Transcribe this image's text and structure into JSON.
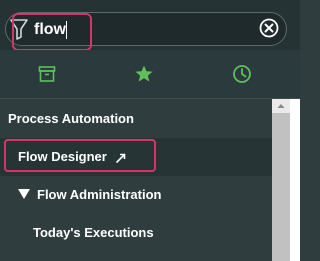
{
  "search": {
    "value": "flow"
  },
  "tabs": [
    {
      "icon": "archive-icon"
    },
    {
      "icon": "star-icon"
    },
    {
      "icon": "clock-icon"
    }
  ],
  "nav": {
    "section_title": "Process Automation",
    "selected_item": "Flow Designer",
    "selected_item_icon": "open-new-window-icon",
    "group_label": "Flow Administration",
    "group_state": "expanded",
    "child_item": "Today's Executions"
  },
  "colors": {
    "accent_green": "#5dc05a",
    "highlight_pink": "#d4356a",
    "panel_bg": "#2f3d3f"
  }
}
